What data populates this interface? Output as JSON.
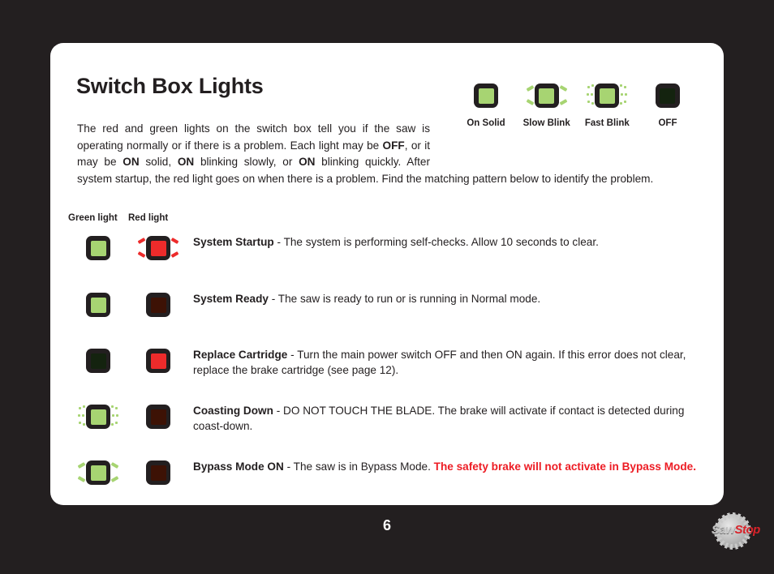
{
  "page": {
    "background_color": "#231f20",
    "card_color": "#ffffff",
    "page_number": "6"
  },
  "header": {
    "title": "Switch Box Lights"
  },
  "intro": {
    "segment_1": "The red and green lights on the switch box tell you if the saw is operating normally or if there is a problem. Each light may be ",
    "bold_1": "OFF",
    "segment_2": ", or it may be ",
    "bold_2": "ON",
    "segment_3": " solid, ",
    "bold_3": "ON",
    "segment_4": " blinking slowly, or ",
    "bold_4": "ON",
    "segment_5": " blinking quickly. After system startup, the red light goes on when there is a problem. Find the matching pattern below to identify the problem."
  },
  "legend": {
    "items": [
      {
        "label": "On Solid",
        "icon": "led-green-on-solid",
        "state": "solid",
        "color": "#a7d472"
      },
      {
        "label": "Slow Blink",
        "icon": "led-green-slow-blink",
        "state": "slow",
        "color": "#a7d472"
      },
      {
        "label": "Fast Blink",
        "icon": "led-green-fast-blink",
        "state": "fast",
        "color": "#a7d472"
      },
      {
        "label": "OFF",
        "icon": "led-green-off",
        "state": "off",
        "color": "#14230f"
      }
    ]
  },
  "table": {
    "headers": {
      "green": "Green light",
      "red": "Red light"
    },
    "rows": [
      {
        "green": {
          "state": "solid",
          "color": "#a7d472",
          "icon": "led-green-on-solid"
        },
        "red": {
          "state": "slow",
          "color": "#ed2b2b",
          "icon": "led-red-slow-blink"
        },
        "title": "System Startup",
        "dash": " - ",
        "body": "The system is performing self-checks. Allow 10 seconds to clear.",
        "warning": ""
      },
      {
        "green": {
          "state": "solid",
          "color": "#a7d472",
          "icon": "led-green-on-solid"
        },
        "red": {
          "state": "off",
          "color": "#3d1205",
          "icon": "led-red-off"
        },
        "title": "System Ready",
        "dash": " - ",
        "body": "The saw is ready to run or is running in Normal mode.",
        "warning": ""
      },
      {
        "green": {
          "state": "off",
          "color": "#14230f",
          "icon": "led-green-off"
        },
        "red": {
          "state": "solid",
          "color": "#ed2b2b",
          "icon": "led-red-on-solid"
        },
        "title": "Replace Cartridge",
        "dash": " - ",
        "body": "Turn the main power switch OFF and then ON again. If this error does not clear, replace the brake cartridge (see page 12).",
        "warning": ""
      },
      {
        "green": {
          "state": "fast",
          "color": "#a7d472",
          "icon": "led-green-fast-blink"
        },
        "red": {
          "state": "off",
          "color": "#3d1205",
          "icon": "led-red-off"
        },
        "title": "Coasting Down",
        "dash": " -  ",
        "body": "DO NOT TOUCH THE BLADE. The brake will activate if contact is detected during coast-down.",
        "warning": ""
      },
      {
        "green": {
          "state": "slow",
          "color": "#a7d472",
          "icon": "led-green-slow-blink"
        },
        "red": {
          "state": "off",
          "color": "#3d1205",
          "icon": "led-red-off"
        },
        "title": "Bypass Mode ON",
        "dash": " - ",
        "body": "The saw is in Bypass Mode.  ",
        "warning": "The safety brake will not activate in Bypass Mode."
      }
    ]
  },
  "logo": {
    "saw": "Saw",
    "stop": "Stop",
    "saw_color": "#c6c6c6",
    "stop_color": "#d8232a"
  }
}
